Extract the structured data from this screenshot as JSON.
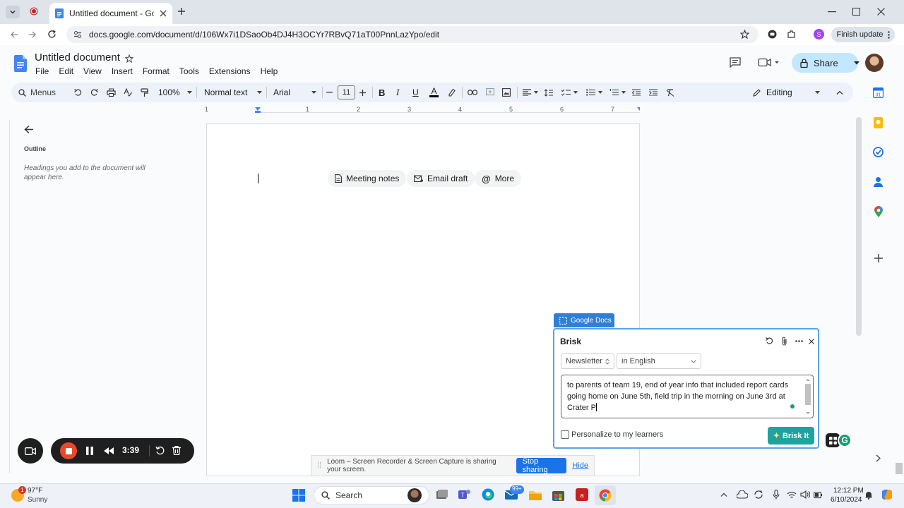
{
  "browser": {
    "tab_title": "Untitled document - Google Do",
    "url": "docs.google.com/document/d/106Wx7i1DSaoOb4DJ4H3OCYr7RBvQ71aT00PnnLazYpo/edit",
    "finish_update": "Finish update",
    "profile_initial": "S"
  },
  "doc": {
    "title": "Untitled document",
    "menus": [
      "File",
      "Edit",
      "View",
      "Insert",
      "Format",
      "Tools",
      "Extensions",
      "Help"
    ],
    "share_label": "Share",
    "toolbar": {
      "menus": "Menus",
      "zoom": "100%",
      "style": "Normal text",
      "font": "Arial",
      "size": "11",
      "mode": "Editing"
    },
    "ruler_marks": [
      "1",
      "1",
      "2",
      "3",
      "4",
      "5",
      "6",
      "7"
    ],
    "outline": {
      "title": "Outline",
      "description": "Headings you add to the document will appear here."
    },
    "chips": [
      "Meeting notes",
      "Email draft",
      "More"
    ]
  },
  "brisk": {
    "tag": "Google Docs",
    "title": "Brisk",
    "type_select": "Newsletter",
    "language_select": "in English",
    "prompt_text": "to parents of team 19, end of year info that included report cards going home on June 5th, field trip in the morning on June 3rd at Crater P",
    "personalize_label": "Personalize to my learners",
    "button_label": "Brisk It"
  },
  "loom": {
    "timer": "3:39",
    "sharing_message": "Loom – Screen Recorder & Screen Capture is sharing your screen.",
    "stop_label": "Stop sharing",
    "hide_label": "Hide"
  },
  "taskbar": {
    "weather_temp": "97°F",
    "weather_desc": "Sunny",
    "weather_badge": "1",
    "search_label": "Search",
    "mail_badge": "99+",
    "time": "12:12 PM",
    "date": "6/10/2024"
  },
  "colors": {
    "share_bg": "#c2e7ff",
    "brisk_accent": "#1ea3a0",
    "loom_stop": "#1a73e8",
    "record_red": "#e8492d"
  }
}
